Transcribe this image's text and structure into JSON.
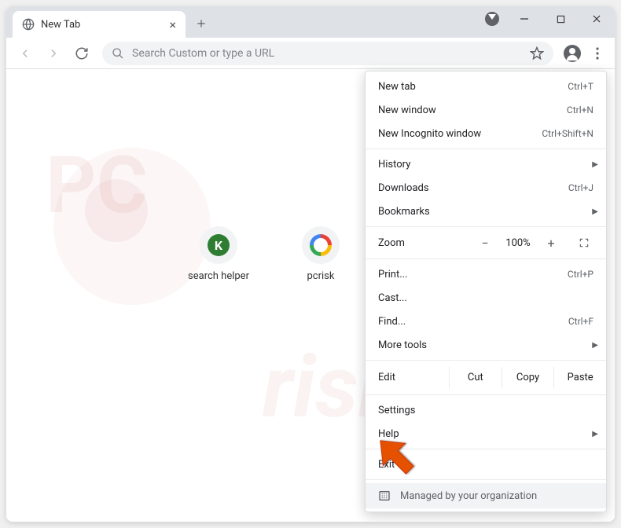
{
  "tab": {
    "title": "New Tab",
    "close": "×"
  },
  "toolbar": {
    "omnibox_placeholder": "Search Custom or type a URL"
  },
  "shortcuts": [
    {
      "label": "search helper",
      "letter": "K"
    },
    {
      "label": "pcrisk",
      "letter": "G"
    }
  ],
  "menu": {
    "new_tab": {
      "label": "New tab",
      "shortcut": "Ctrl+T"
    },
    "new_window": {
      "label": "New window",
      "shortcut": "Ctrl+N"
    },
    "incognito": {
      "label": "New Incognito window",
      "shortcut": "Ctrl+Shift+N"
    },
    "history": {
      "label": "History"
    },
    "downloads": {
      "label": "Downloads",
      "shortcut": "Ctrl+J"
    },
    "bookmarks": {
      "label": "Bookmarks"
    },
    "zoom": {
      "label": "Zoom",
      "minus": "−",
      "value": "100%",
      "plus": "+"
    },
    "print": {
      "label": "Print...",
      "shortcut": "Ctrl+P"
    },
    "cast": {
      "label": "Cast..."
    },
    "find": {
      "label": "Find...",
      "shortcut": "Ctrl+F"
    },
    "more_tools": {
      "label": "More tools"
    },
    "edit": {
      "label": "Edit",
      "cut": "Cut",
      "copy": "Copy",
      "paste": "Paste"
    },
    "settings": {
      "label": "Settings"
    },
    "help": {
      "label": "Help"
    },
    "exit": {
      "label": "Exit"
    },
    "managed": {
      "label": "Managed by your organization"
    }
  }
}
